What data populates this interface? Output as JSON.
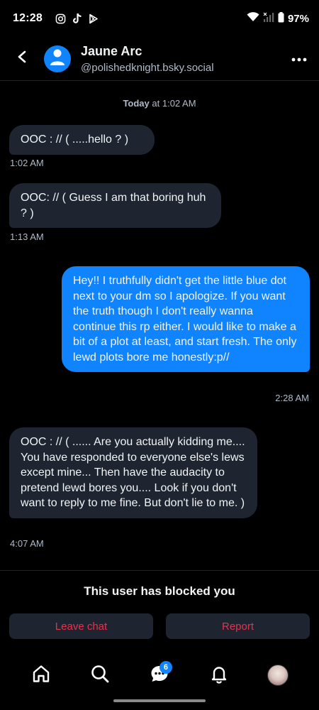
{
  "status_bar": {
    "time": "12:28",
    "battery": "97%",
    "icons": [
      "instagram-icon",
      "tiktok-icon",
      "play-store-icon",
      "wifi-icon",
      "signal-icon",
      "battery-icon"
    ]
  },
  "header": {
    "name": "Jaune Arc",
    "handle": "@polishedknight.bsky.social",
    "icons": [
      "back-arrow-icon",
      "default-avatar-icon",
      "more-options-icon"
    ]
  },
  "conversation": {
    "date_label_bold": "Today",
    "date_label_rest": " at 1:02 AM",
    "messages": [
      {
        "from": "them",
        "text": "OOC : // ( .....hello ? )",
        "time": "1:02 AM"
      },
      {
        "from": "them",
        "text": "OOC: // ( Guess I am that boring huh ? )",
        "time": "1:13 AM"
      },
      {
        "from": "me",
        "text": "Hey!! I truthfully didn't get the little blue dot next to your dm so I apologize. If you want the truth though I don't really wanna continue this rp either. I would like to make a bit of a plot at least, and start fresh. The only lewd plots bore me honestly:p//",
        "time": "2:28 AM"
      },
      {
        "from": "them",
        "text": "OOC : // ( ...... Are you actually kidding me.... You have responded to everyone else's lews except mine... Then have the audacity to pretend lewd bores you.... Look if you don't want to reply to me fine. But don't lie to me. )",
        "time": "4:07 AM"
      }
    ]
  },
  "blocked": {
    "message": "This user has blocked you",
    "leave_label": "Leave chat",
    "report_label": "Report",
    "accent_color": "#e8314d"
  },
  "bottom_nav": {
    "items": [
      "home-icon",
      "search-icon",
      "chat-icon",
      "notifications-icon",
      "profile-avatar"
    ],
    "chat_badge": "6"
  },
  "colors": {
    "background": "#000000",
    "incoming_bubble": "#1e2530",
    "outgoing_bubble": "#1083fe",
    "muted_text": "#aebbc9"
  }
}
